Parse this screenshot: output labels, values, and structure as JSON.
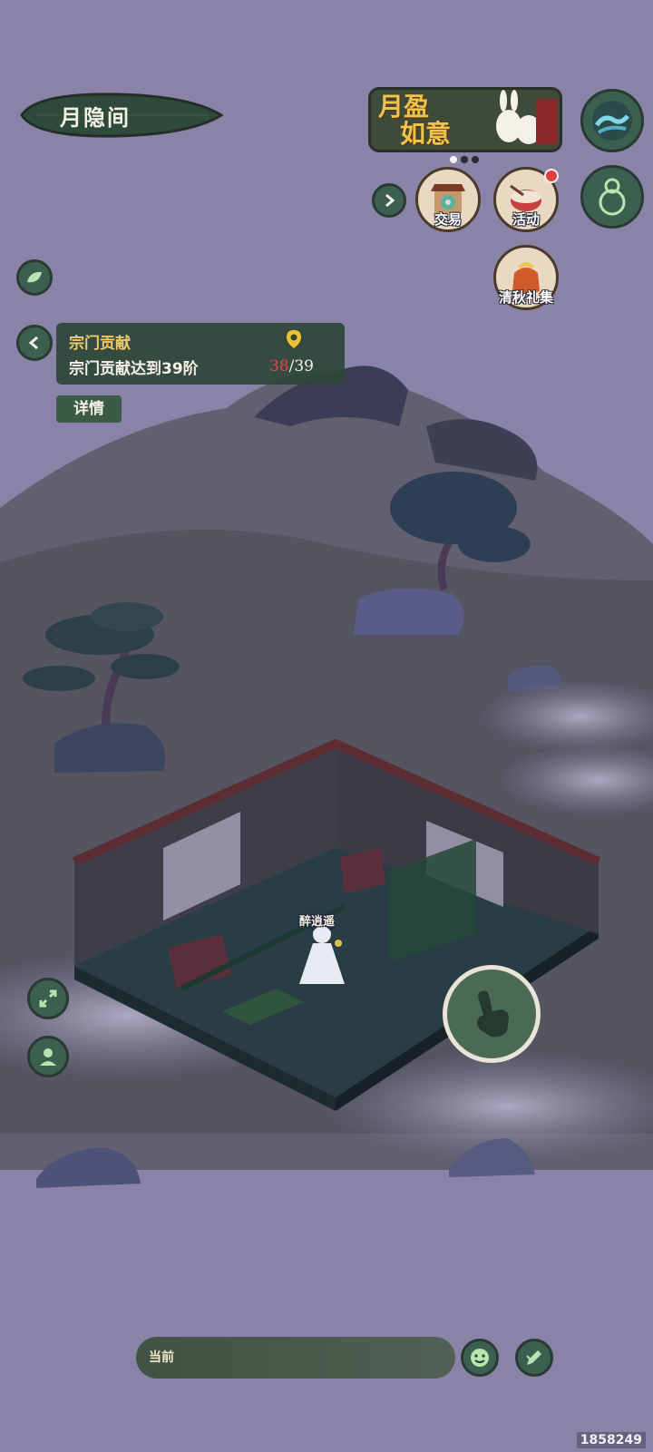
{
  "location": {
    "name": "月隐间"
  },
  "event_banner": {
    "title_line1": "月盈",
    "title_line2": "如意",
    "pages": 3,
    "active_page": 0
  },
  "top_menu": {
    "trade_label": "交易",
    "activity_label": "活动",
    "gift_label": "清秋礼集",
    "activity_has_notification": true
  },
  "quest": {
    "title": "宗门贡献",
    "description": "宗门贡献达到39阶",
    "current": "38",
    "separator": "/",
    "total": "39",
    "details_label": "详情"
  },
  "character": {
    "name": "醉逍遥"
  },
  "chat": {
    "channel_label": "当前"
  },
  "watermark": "1858249",
  "colors": {
    "background": "#8a83a8",
    "panel": "#2e4638",
    "button_green": "#3c5a48",
    "gold_text": "#f0c968",
    "progress_red": "#e04848"
  },
  "icons": {
    "wave": "wave-icon",
    "gourd": "gourd-icon",
    "leaf": "leaf-icon",
    "back": "chevron-left-icon",
    "location": "map-pin-icon",
    "expand": "chevron-right-icon",
    "fullscreen": "expand-arrows-icon",
    "profile": "person-icon",
    "touch": "hand-pointer-icon",
    "emoji": "emoji-icon",
    "write": "pen-icon"
  }
}
